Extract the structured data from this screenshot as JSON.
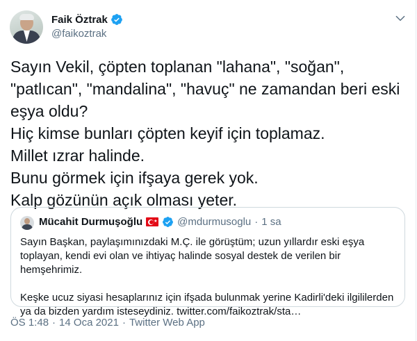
{
  "tweet": {
    "author_name": "Faik Öztrak",
    "author_handle": "@faikoztrak",
    "text": "Sayın Vekil, çöpten toplanan \"lahana\", \"soğan\",\n\"patlıcan\", \"mandalina\", \"havuç\" ne zamandan beri eski\neşya oldu?\nHiç kimse bunları çöpten keyif için toplamaz.\nMillet ızrar halinde.\nBunu görmek için ifşaya gerek yok.\nKalp gözünün açık olması yeter.",
    "time": "ÖS 1:48",
    "date": "14 Oca 2021",
    "app": "Twitter Web App",
    "dot": "·"
  },
  "quoted": {
    "author_name": "Mücahit Durmuşoğlu",
    "author_handle": "@mdurmusoglu",
    "dot": "·",
    "time": "1 sa",
    "paragraph1": "Sayın Başkan, paylaşımınızdaki M.Ç. ile görüştüm; uzun yıllardır eski eşya toplayan, kendi evi olan ve ihtiyaç halinde sosyal destek de verilen bir hemşehrimiz.",
    "paragraph2": "Keşke ucuz siyasi hesaplarınız için ifşada bulunmak yerine Kadirli'deki ilgililerden ya da bizden yardım isteseydiniz. twitter.com/faikoztrak/sta…"
  },
  "icons": {
    "verified": "verified-badge-icon",
    "more": "more-options-icon",
    "flag": "turkey-flag-icon"
  },
  "colors": {
    "verified": "#1da1f2",
    "secondary_text": "#5b7083",
    "border": "#cfd9de"
  }
}
